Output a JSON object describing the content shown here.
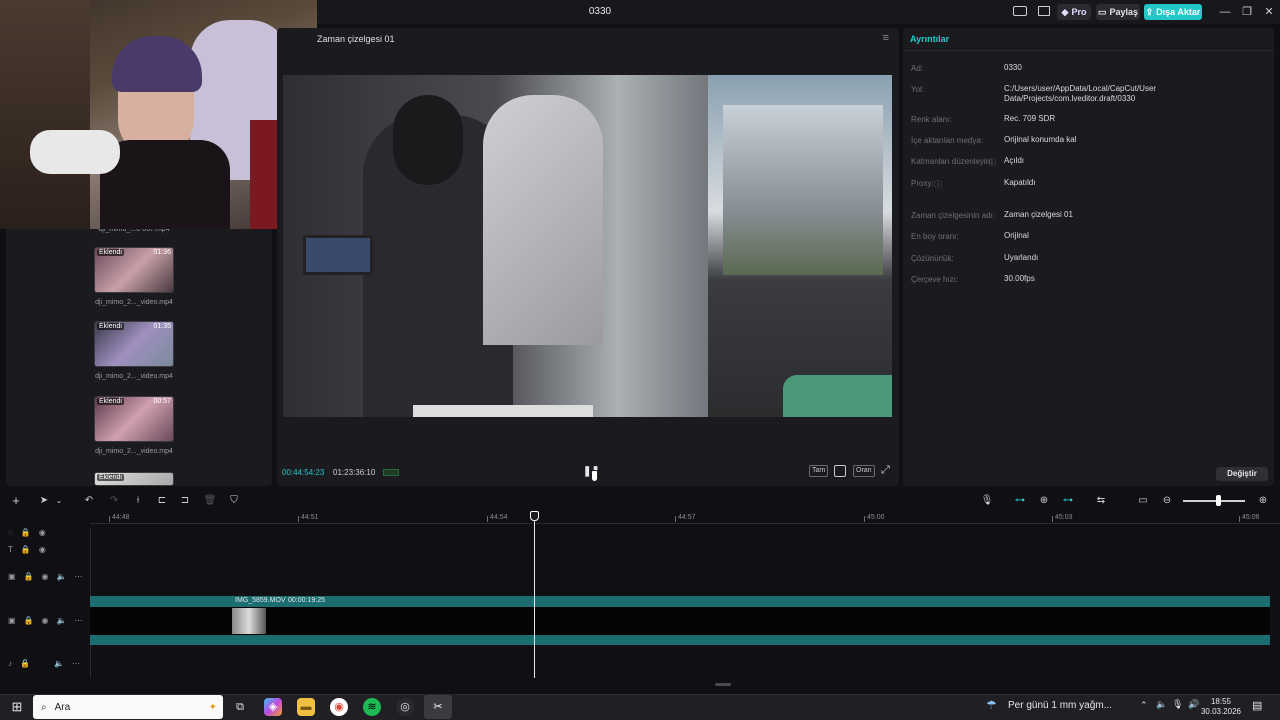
{
  "window": {
    "title": "0330",
    "pro_label": "Pro",
    "share_label": "Paylaş",
    "export_label": "Dışa Aktar",
    "minimize_icon": "—",
    "maximize_icon": "❐",
    "close_icon": "✕"
  },
  "media": {
    "items": [
      {
        "name": "dji_mimo_...0-007.mp4",
        "added": "",
        "duration": ""
      },
      {
        "name": "dji_mimo_2..._video.mp4",
        "added": "Eklendi",
        "duration": "01:36"
      },
      {
        "name": "dji_mimo_2..._video.mp4",
        "added": "Eklendi",
        "duration": "01:35"
      },
      {
        "name": "dji_mimo_2..._video.mp4",
        "added": "Eklendi",
        "duration": "00:57"
      },
      {
        "name": "",
        "added": "Eklendi",
        "duration": ""
      }
    ]
  },
  "preview": {
    "timeline_name": "Zaman çizelgesi 01",
    "current_time": "00:44:54:23",
    "total_time": "01:23:36:10",
    "full_label": "Tam",
    "ratio_label": "Oran"
  },
  "details": {
    "tab_label": "Ayrıntılar",
    "rows": [
      {
        "label": "Ad:",
        "value": "0330"
      },
      {
        "label": "Yol:",
        "value": "C:/Users/user/AppData/Local/CapCut/User Data/Projects/com.lveditor.draft/0330"
      },
      {
        "label": "Renk alanı:",
        "value": "Rec. 709 SDR"
      },
      {
        "label": "İçe aktarılan medya:",
        "value": "Orijinal konumda kal"
      },
      {
        "label": "Katmanları düzenleyin:",
        "value": "Açıldı"
      },
      {
        "label": "Proxy:",
        "value": "Kapatıldı"
      },
      {
        "label": "Zaman çizelgesinin adı:",
        "value": "Zaman çizelgesi 01"
      },
      {
        "label": "En boy oranı:",
        "value": "Orijinal"
      },
      {
        "label": "Çözünürlük:",
        "value": "Uyarlandı"
      },
      {
        "label": "Çerçeve hızı:",
        "value": "30.00fps"
      }
    ],
    "change_label": "Değiştir"
  },
  "timeline": {
    "ruler_ticks": [
      "44:48",
      "44:51",
      "44:54",
      "44:57",
      "45:00",
      "45:03",
      "45:06"
    ],
    "clip_name": "IMG_5859.MOV",
    "clip_duration": "00:00:19:25"
  },
  "taskbar": {
    "search_placeholder": "Ara",
    "weather_text": "Per günü 1 mm yağm...",
    "time": "18:55",
    "date": "30.03.2026"
  },
  "colors": {
    "accent": "#23c7c9",
    "panel_bg": "#1b1b1f",
    "track_teal": "#1b6e70"
  }
}
